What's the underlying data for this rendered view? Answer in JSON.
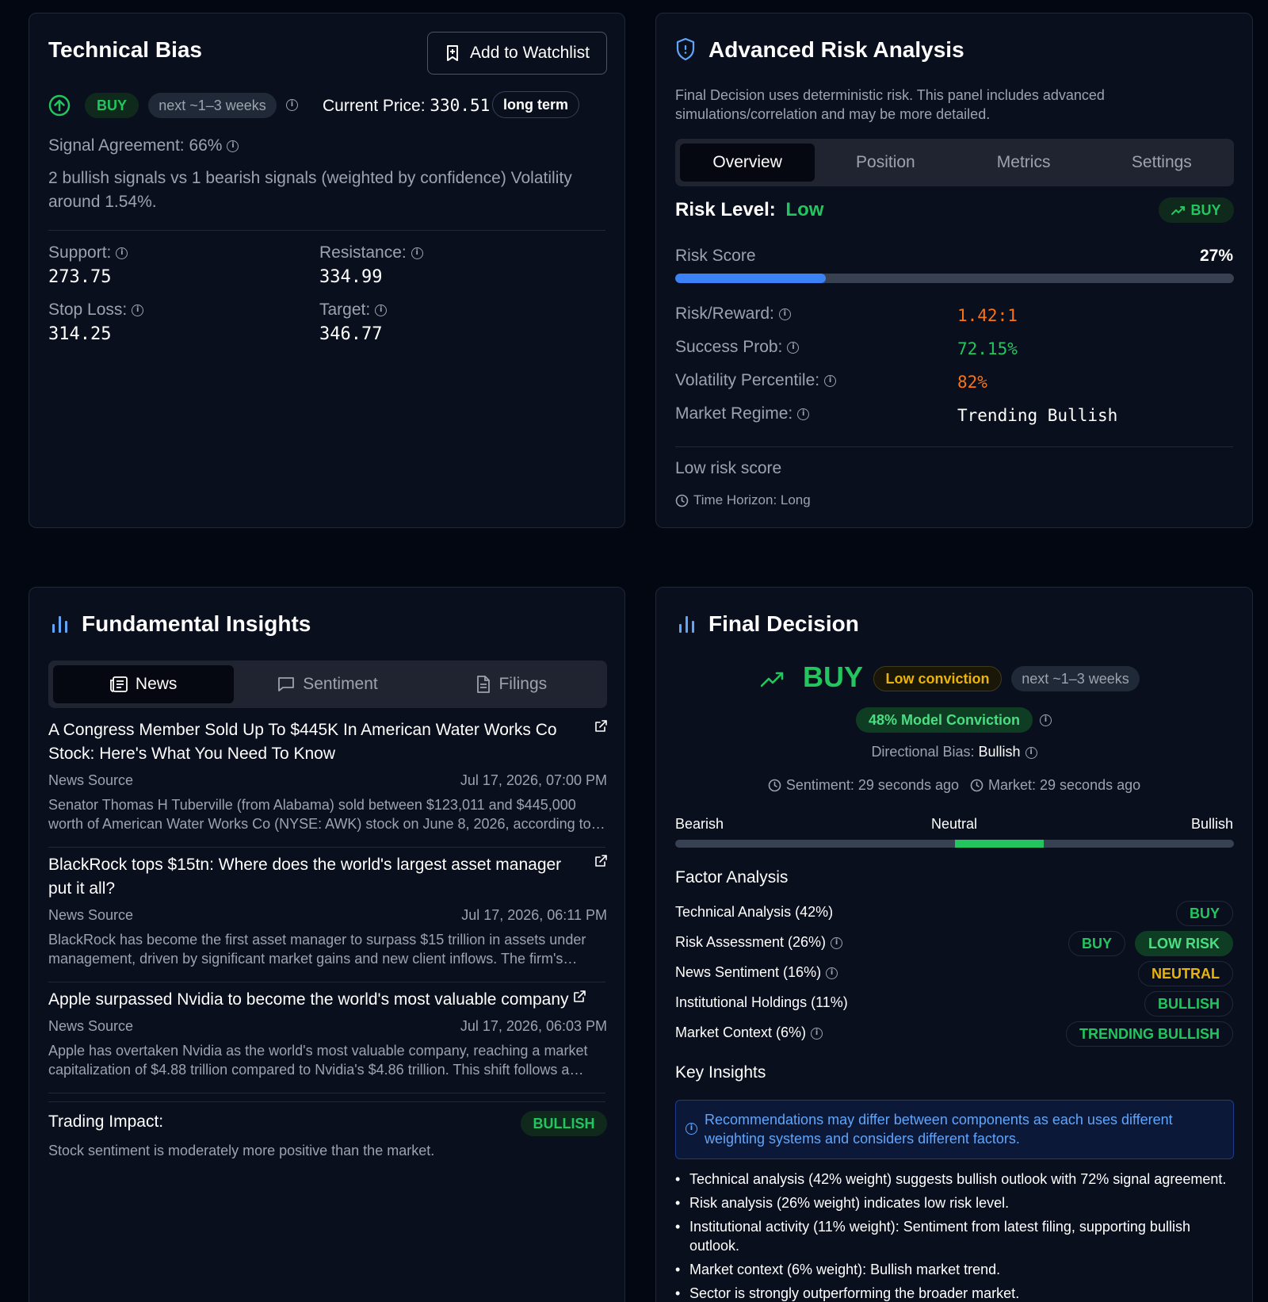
{
  "technical_bias": {
    "title": "Technical Bias",
    "watchlist_button": "Add to Watchlist",
    "signal": "BUY",
    "horizon": "next ~1–3 weeks",
    "current_price_label": "Current Price:",
    "current_price": "330.51",
    "term": "long term",
    "signal_agreement": "Signal Agreement: 66%",
    "summary": "2 bullish signals vs 1 bearish signals (weighted by confidence) Volatility around 1.54%.",
    "levels": [
      {
        "label": "Support:",
        "value": "273.75"
      },
      {
        "label": "Resistance:",
        "value": "334.99"
      },
      {
        "label": "Stop Loss:",
        "value": "314.25"
      },
      {
        "label": "Target:",
        "value": "346.77"
      }
    ]
  },
  "risk": {
    "title": "Advanced Risk Analysis",
    "description": "Final Decision uses deterministic risk. This panel includes advanced simulations/correlation and may be more detailed.",
    "tabs": [
      "Overview",
      "Position",
      "Metrics",
      "Settings"
    ],
    "risk_level_label": "Risk Level:",
    "risk_level": "Low",
    "signal": "BUY",
    "risk_score_label": "Risk Score",
    "risk_score": "27%",
    "risk_score_fraction": 0.27,
    "metrics": [
      {
        "label": "Risk/Reward:",
        "value": "1.42:1",
        "color": "#f97316"
      },
      {
        "label": "Success Prob:",
        "value": "72.15%",
        "color": "#22c55e"
      },
      {
        "label": "Volatility Percentile:",
        "value": "82%",
        "color": "#f97316"
      },
      {
        "label": "Market Regime:",
        "value": "Trending Bullish",
        "color": "#ffffff"
      }
    ],
    "footer_title": "Low risk score",
    "time_horizon": "Time Horizon: Long"
  },
  "fundamentals": {
    "title": "Fundamental Insights",
    "tabs": [
      "News",
      "Sentiment",
      "Filings"
    ],
    "news": [
      {
        "title": "A Congress Member Sold Up To $445K In American Water Works Co Stock: Here's What You Need To Know",
        "source": "News Source",
        "date": "Jul 17, 2026, 07:00 PM",
        "body": "Senator Thomas H Tuberville (from Alabama) sold between $123,011 and $445,000 worth of American Water Works Co (NYSE: AWK) stock on June 8, 2026, according to the latest disclosure."
      },
      {
        "title": "BlackRock tops $15tn: Where does the world's largest asset manager put it all?",
        "source": "News Source",
        "date": "Jul 17, 2026, 06:11 PM",
        "body": "BlackRock has become the first asset manager to surpass $15 trillion in assets under management, driven by significant market gains and new client inflows. The firm's growth continues."
      },
      {
        "title": "Apple surpassed Nvidia to become the world's most valuable company",
        "source": "News Source",
        "date": "Jul 17, 2026, 06:03 PM",
        "body": "Apple has overtaken Nvidia as the world's most valuable company, reaching a market capitalization of $4.88 trillion compared to Nvidia's $4.86 trillion. This shift follows a strong rally."
      }
    ],
    "trading_impact_label": "Trading Impact:",
    "trading_impact": "BULLISH",
    "trading_impact_text": "Stock sentiment is moderately more positive than the market."
  },
  "final": {
    "title": "Final Decision",
    "decision": "BUY",
    "conviction": "Low conviction",
    "horizon": "next ~1–3 weeks",
    "model_conviction": "48% Model Conviction",
    "directional_bias_label": "Directional Bias:",
    "directional_bias": "Bullish",
    "sentiment_time": "Sentiment: 29 seconds ago",
    "market_time": "Market: 29 seconds ago",
    "scale": {
      "left": "Bearish",
      "mid": "Neutral",
      "right": "Bullish",
      "fill_start": 0.5,
      "fill_end": 0.66
    },
    "factor_title": "Factor Analysis",
    "factors": [
      {
        "label": "Technical Analysis (42%)",
        "info": false,
        "badges": [
          {
            "text": "BUY",
            "color": "#22c55e"
          }
        ]
      },
      {
        "label": "Risk Assessment (26%)",
        "info": true,
        "badges": [
          {
            "text": "BUY",
            "color": "#22c55e"
          },
          {
            "text": "LOW RISK",
            "color": "#22c55e",
            "filled": true
          }
        ]
      },
      {
        "label": "News Sentiment (16%)",
        "info": true,
        "badges": [
          {
            "text": "NEUTRAL",
            "color": "#eab308"
          }
        ]
      },
      {
        "label": "Institutional Holdings (11%)",
        "info": false,
        "badges": [
          {
            "text": "BULLISH",
            "color": "#22c55e"
          }
        ]
      },
      {
        "label": "Market Context (6%)",
        "info": true,
        "badges": [
          {
            "text": "TRENDING BULLISH",
            "color": "#22c55e"
          }
        ]
      }
    ],
    "insights_title": "Key Insights",
    "notice": "Recommendations may differ between components as each uses different weighting systems and considers different factors.",
    "insights": [
      "Technical analysis (42% weight) suggests bullish outlook with 72% signal agreement.",
      "Risk analysis (26% weight) indicates low risk level.",
      "Institutional activity (11% weight): Sentiment from latest filing, supporting bullish outlook.",
      "Market context (6% weight): Bullish market trend.",
      "Sector is strongly outperforming the broader market."
    ]
  }
}
